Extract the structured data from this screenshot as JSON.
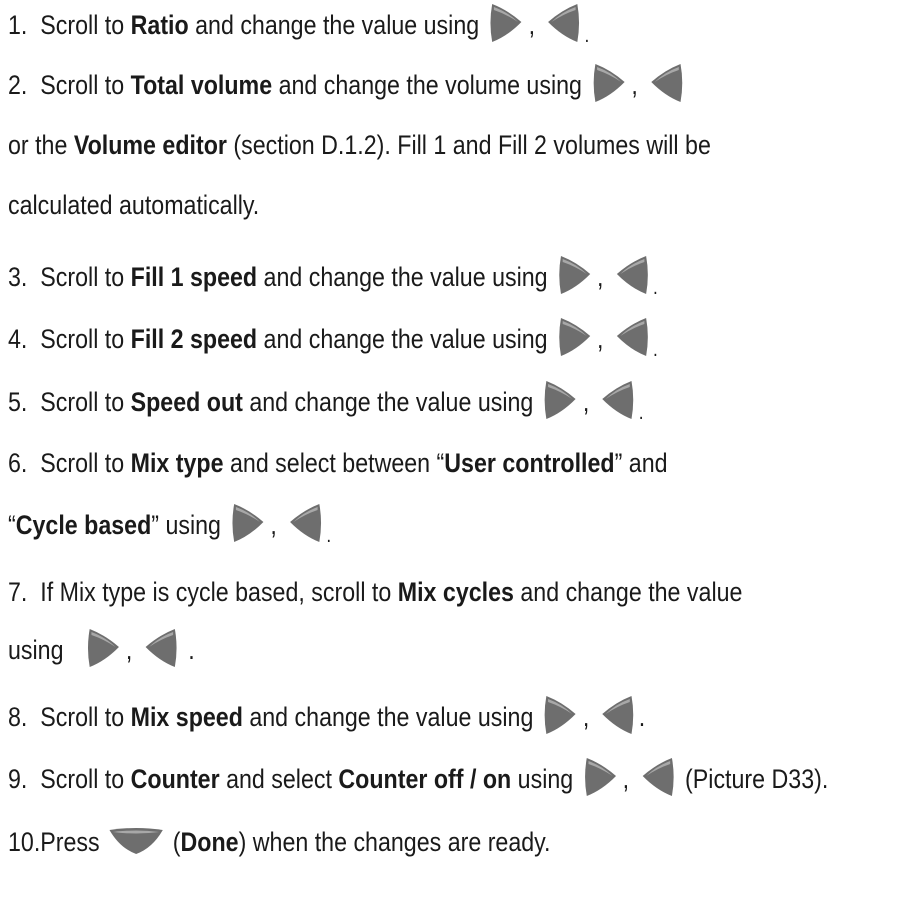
{
  "lines": {
    "l1": {
      "num": "1.",
      "pre": "Scroll to ",
      "b1": "Ratio",
      "post": " and change the value using",
      "comma": ",",
      "end": "."
    },
    "l2": {
      "num": "2.",
      "pre": "Scroll to ",
      "b1": "Total volume",
      "post": " and change the volume using",
      "comma": ","
    },
    "l2b": {
      "pre": "or the ",
      "b1": "Volume editor",
      "post": " (section D.1.2). Fill 1 and Fill 2 volumes will be"
    },
    "l2c": {
      "text": "calculated automatically."
    },
    "l3": {
      "num": "3.",
      "pre": "Scroll to ",
      "b1": "Fill 1 speed",
      "post": " and change the value using",
      "comma": ",",
      "end": "."
    },
    "l4": {
      "num": "4.",
      "pre": "Scroll to ",
      "b1": "Fill 2 speed",
      "post": " and change the value using",
      "comma": ",",
      "end": "."
    },
    "l5": {
      "num": "5.",
      "pre": "Scroll to ",
      "b1": "Speed out",
      "post": " and change the value using",
      "comma": ",",
      "end": "."
    },
    "l6": {
      "num": "6.",
      "pre": "Scroll to ",
      "b1": "Mix type",
      "post": " and select between “",
      "b2": "User controlled",
      "post2": "” and"
    },
    "l6b": {
      "q1": "“",
      "b1": "Cycle based",
      "post": "” using",
      "comma": ",",
      "end": "."
    },
    "l7": {
      "num": "7.",
      "pre": "If Mix type is cycle based, scroll to ",
      "b1": "Mix cycles",
      "post": " and change the value"
    },
    "l7b": {
      "pre": "using",
      "comma": ",",
      "end": "."
    },
    "l8": {
      "num": "8.",
      "pre": "Scroll to ",
      "b1": "Mix speed",
      "post": " and change the value using",
      "comma": ",",
      "end": "."
    },
    "l9": {
      "num": "9.",
      "pre": "Scroll to ",
      "b1": "Counter",
      "mid": " and select ",
      "b2": "Counter off / on",
      "post": " using",
      "comma": ",",
      "tail": "(Picture D33)."
    },
    "l10": {
      "num": "10.",
      "pre": "Press",
      "paren1": "(",
      "b1": "Done",
      "post": ") when the changes are ready."
    }
  },
  "icons": {
    "right": "right-arrow-key-icon",
    "left": "left-arrow-key-icon",
    "down": "down-arrow-key-icon"
  },
  "colors": {
    "text": "#1a1a1a",
    "key": "#6e6e6e"
  }
}
